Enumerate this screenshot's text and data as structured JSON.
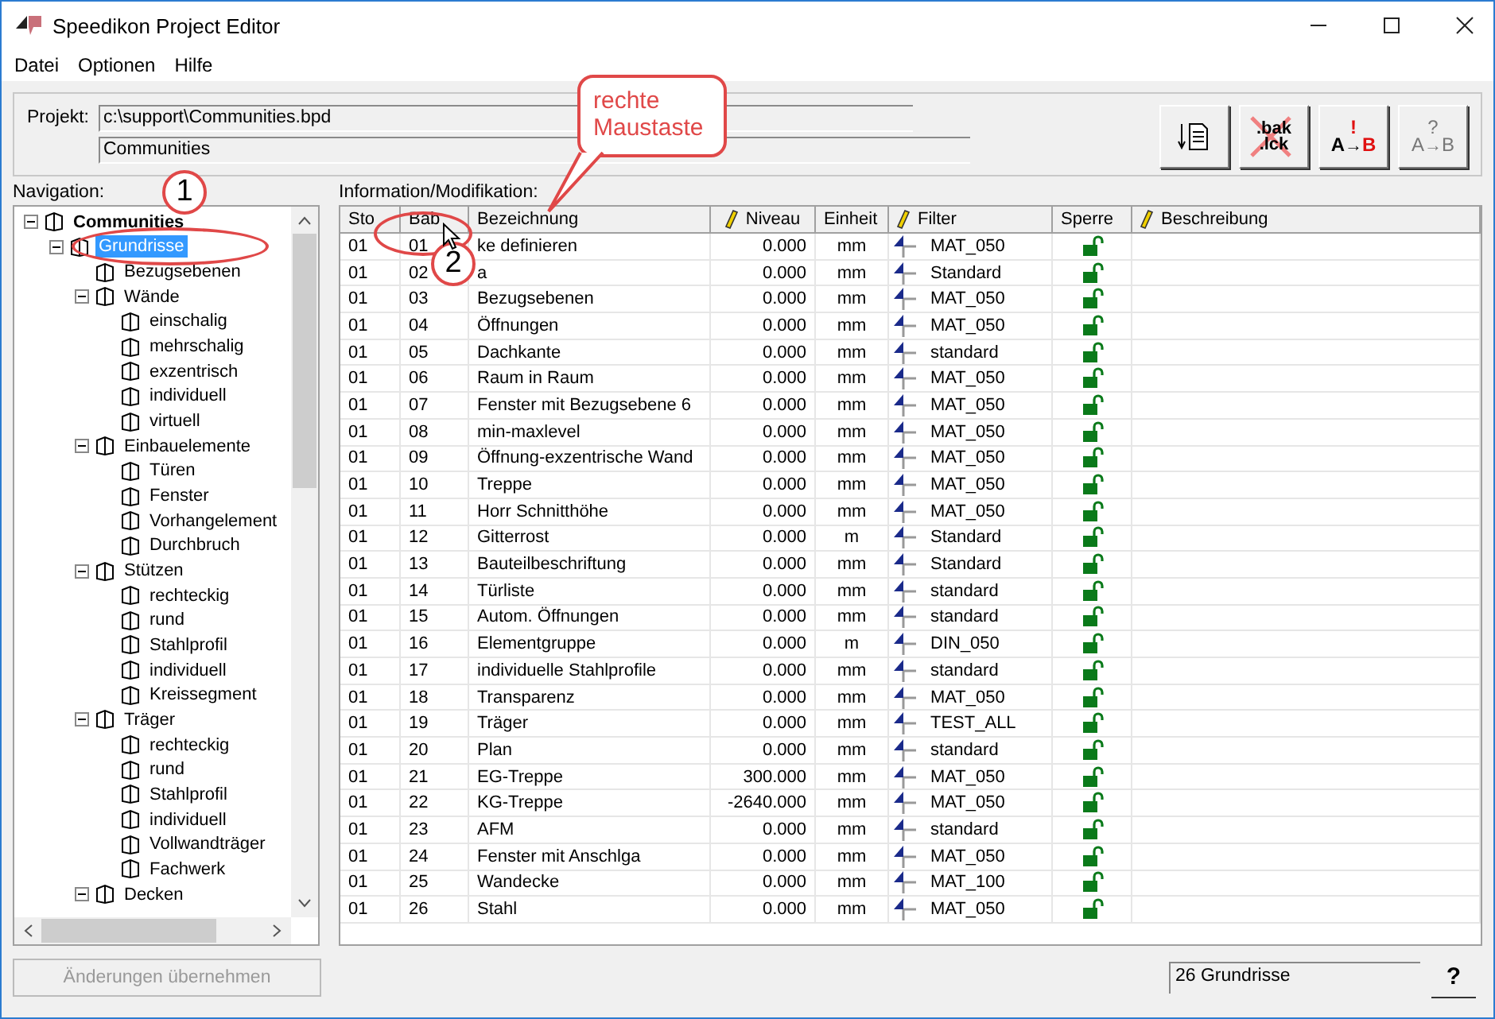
{
  "window": {
    "title": "Speedikon Project Editor"
  },
  "menu": [
    "Datei",
    "Optionen",
    "Hilfe"
  ],
  "project": {
    "label": "Projekt:",
    "path": "c:\\support\\Communities.bpd",
    "name": "Communities"
  },
  "tool_buttons": [
    {
      "kind": "import",
      "disabled": false
    },
    {
      "kind": "backup",
      "lines": [
        ".bak",
        ".lck"
      ],
      "disabled": false
    },
    {
      "kind": "transfer",
      "mark": "!",
      "from": "A",
      "arrow": "→",
      "to": "B",
      "disabled": false
    },
    {
      "kind": "transfer",
      "mark": "?",
      "from": "A",
      "arrow": "→",
      "to": "B",
      "disabled": true
    }
  ],
  "navigation": {
    "label": "Navigation:",
    "tree": [
      {
        "label": "Communities",
        "selected": false,
        "expanded": true,
        "children": [
          {
            "label": "Grundrisse",
            "selected": true,
            "expanded": true,
            "children": [
              {
                "label": "Bezugsebenen",
                "selected": false
              },
              {
                "label": "Wände",
                "selected": false,
                "expanded": true,
                "children": [
                  {
                    "label": "einschalig",
                    "selected": false
                  },
                  {
                    "label": "mehrschalig",
                    "selected": false
                  },
                  {
                    "label": "exzentrisch",
                    "selected": false
                  },
                  {
                    "label": "individuell",
                    "selected": false
                  },
                  {
                    "label": "virtuell",
                    "selected": false
                  }
                ]
              },
              {
                "label": "Einbauelemente",
                "selected": false,
                "expanded": true,
                "children": [
                  {
                    "label": "Türen",
                    "selected": false
                  },
                  {
                    "label": "Fenster",
                    "selected": false
                  },
                  {
                    "label": "Vorhangelement",
                    "selected": false
                  },
                  {
                    "label": "Durchbruch",
                    "selected": false
                  }
                ]
              },
              {
                "label": "Stützen",
                "selected": false,
                "expanded": true,
                "children": [
                  {
                    "label": "rechteckig",
                    "selected": false
                  },
                  {
                    "label": "rund",
                    "selected": false
                  },
                  {
                    "label": "Stahlprofil",
                    "selected": false
                  },
                  {
                    "label": "individuell",
                    "selected": false
                  },
                  {
                    "label": "Kreissegment",
                    "selected": false
                  }
                ]
              },
              {
                "label": "Träger",
                "selected": false,
                "expanded": true,
                "children": [
                  {
                    "label": "rechteckig",
                    "selected": false
                  },
                  {
                    "label": "rund",
                    "selected": false
                  },
                  {
                    "label": "Stahlprofil",
                    "selected": false
                  },
                  {
                    "label": "individuell",
                    "selected": false
                  },
                  {
                    "label": "Vollwandträger",
                    "selected": false
                  },
                  {
                    "label": "Fachwerk",
                    "selected": false
                  }
                ]
              },
              {
                "label": "Decken",
                "selected": false,
                "expanded": true
              }
            ]
          }
        ]
      }
    ]
  },
  "table": {
    "label": "Information/Modifikation:",
    "columns": [
      {
        "label": "Sto",
        "editable": false
      },
      {
        "label": "Bab",
        "editable": false
      },
      {
        "label": "Bezeichnung",
        "editable": false
      },
      {
        "label": "Niveau",
        "editable": true
      },
      {
        "label": "Einheit",
        "editable": false
      },
      {
        "label": "Filter",
        "editable": true
      },
      {
        "label": "Sperre",
        "editable": false
      },
      {
        "label": "Beschreibung",
        "editable": true
      }
    ],
    "rows": [
      {
        "sto": "01",
        "bab": "01",
        "name": "ke definieren",
        "niveau": "0.000",
        "unit": "mm",
        "filter": "MAT_050",
        "locked": false
      },
      {
        "sto": "01",
        "bab": "02",
        "name": "a",
        "niveau": "0.000",
        "unit": "mm",
        "filter": "Standard",
        "locked": false
      },
      {
        "sto": "01",
        "bab": "03",
        "name": "Bezugsebenen",
        "niveau": "0.000",
        "unit": "mm",
        "filter": "MAT_050",
        "locked": false
      },
      {
        "sto": "01",
        "bab": "04",
        "name": "Öffnungen",
        "niveau": "0.000",
        "unit": "mm",
        "filter": "MAT_050",
        "locked": false
      },
      {
        "sto": "01",
        "bab": "05",
        "name": "Dachkante",
        "niveau": "0.000",
        "unit": "mm",
        "filter": "standard",
        "locked": false
      },
      {
        "sto": "01",
        "bab": "06",
        "name": "Raum in Raum",
        "niveau": "0.000",
        "unit": "mm",
        "filter": "MAT_050",
        "locked": false
      },
      {
        "sto": "01",
        "bab": "07",
        "name": "Fenster mit Bezugsebene 6",
        "niveau": "0.000",
        "unit": "mm",
        "filter": "MAT_050",
        "locked": false
      },
      {
        "sto": "01",
        "bab": "08",
        "name": "min-maxlevel",
        "niveau": "0.000",
        "unit": "mm",
        "filter": "MAT_050",
        "locked": false
      },
      {
        "sto": "01",
        "bab": "09",
        "name": "Öffnung-exzentrische Wand",
        "niveau": "0.000",
        "unit": "mm",
        "filter": "MAT_050",
        "locked": false
      },
      {
        "sto": "01",
        "bab": "10",
        "name": "Treppe",
        "niveau": "0.000",
        "unit": "mm",
        "filter": "MAT_050",
        "locked": false
      },
      {
        "sto": "01",
        "bab": "11",
        "name": "Horr Schnitthöhe",
        "niveau": "0.000",
        "unit": "mm",
        "filter": "MAT_050",
        "locked": false
      },
      {
        "sto": "01",
        "bab": "12",
        "name": "Gitterrost",
        "niveau": "0.000",
        "unit": "m",
        "filter": "Standard",
        "locked": false
      },
      {
        "sto": "01",
        "bab": "13",
        "name": "Bauteilbeschriftung",
        "niveau": "0.000",
        "unit": "mm",
        "filter": "Standard",
        "locked": false
      },
      {
        "sto": "01",
        "bab": "14",
        "name": "Türliste",
        "niveau": "0.000",
        "unit": "mm",
        "filter": "standard",
        "locked": false
      },
      {
        "sto": "01",
        "bab": "15",
        "name": "Autom. Öffnungen",
        "niveau": "0.000",
        "unit": "mm",
        "filter": "standard",
        "locked": false
      },
      {
        "sto": "01",
        "bab": "16",
        "name": "Elementgruppe",
        "niveau": "0.000",
        "unit": "m",
        "filter": "DIN_050",
        "locked": false
      },
      {
        "sto": "01",
        "bab": "17",
        "name": "individuelle Stahlprofile",
        "niveau": "0.000",
        "unit": "mm",
        "filter": "standard",
        "locked": false
      },
      {
        "sto": "01",
        "bab": "18",
        "name": "Transparenz",
        "niveau": "0.000",
        "unit": "mm",
        "filter": "MAT_050",
        "locked": false
      },
      {
        "sto": "01",
        "bab": "19",
        "name": "Träger",
        "niveau": "0.000",
        "unit": "mm",
        "filter": "TEST_ALL",
        "locked": false
      },
      {
        "sto": "01",
        "bab": "20",
        "name": "Plan",
        "niveau": "0.000",
        "unit": "mm",
        "filter": "standard",
        "locked": false
      },
      {
        "sto": "01",
        "bab": "21",
        "name": "EG-Treppe",
        "niveau": "300.000",
        "unit": "mm",
        "filter": "MAT_050",
        "locked": false
      },
      {
        "sto": "01",
        "bab": "22",
        "name": "KG-Treppe",
        "niveau": "-2640.000",
        "unit": "mm",
        "filter": "MAT_050",
        "locked": false
      },
      {
        "sto": "01",
        "bab": "23",
        "name": "AFM",
        "niveau": "0.000",
        "unit": "mm",
        "filter": "standard",
        "locked": false
      },
      {
        "sto": "01",
        "bab": "24",
        "name": "Fenster mit Anschlga",
        "niveau": "0.000",
        "unit": "mm",
        "filter": "MAT_050",
        "locked": false
      },
      {
        "sto": "01",
        "bab": "25",
        "name": "Wandecke",
        "niveau": "0.000",
        "unit": "mm",
        "filter": "MAT_100",
        "locked": false
      },
      {
        "sto": "01",
        "bab": "26",
        "name": "Stahl",
        "niveau": "0.000",
        "unit": "mm",
        "filter": "MAT_050",
        "locked": false
      }
    ]
  },
  "apply_button": {
    "label": "Änderungen übernehmen",
    "disabled": true
  },
  "status": "26 Grundrisse",
  "help_button": "?",
  "annotations": {
    "callout": "rechte Maustaste",
    "markers": [
      "1",
      "2"
    ]
  }
}
